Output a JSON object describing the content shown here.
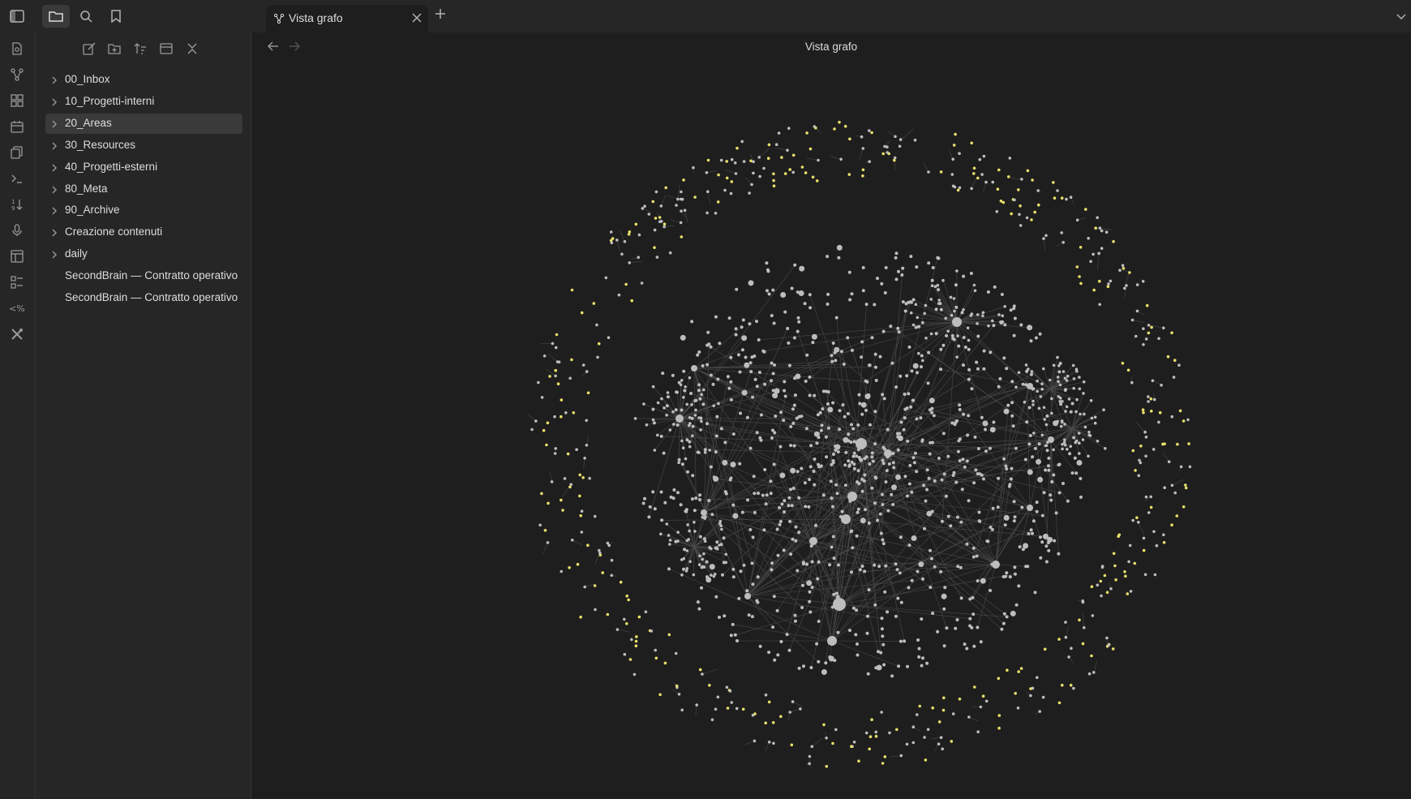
{
  "titlebar": {
    "buttons": [
      "sidebar-toggle-icon",
      "folder-icon",
      "search-icon",
      "bookmark-icon"
    ]
  },
  "tab": {
    "label": "Vista grafo",
    "icon": "graph-icon"
  },
  "ribbon": {
    "icons": [
      "file-search-icon",
      "graph-icon",
      "grid-icon",
      "calendar-icon",
      "copy-icon",
      "terminal-icon",
      "sort-numeric-icon",
      "microphone-icon",
      "layout-icon",
      "list-checks-icon",
      "template-icon",
      "tools-icon"
    ]
  },
  "sidebar": {
    "tools": [
      "new-note-icon",
      "new-folder-icon",
      "sort-icon",
      "collapse-view-icon",
      "collapse-all-icon"
    ],
    "items": [
      {
        "label": "00_Inbox",
        "folder": true
      },
      {
        "label": "10_Progetti-interni",
        "folder": true
      },
      {
        "label": "20_Areas",
        "folder": true,
        "selected": true
      },
      {
        "label": "30_Resources",
        "folder": true
      },
      {
        "label": "40_Progetti-esterni",
        "folder": true
      },
      {
        "label": "80_Meta",
        "folder": true
      },
      {
        "label": "90_Archive",
        "folder": true
      },
      {
        "label": "Creazione contenuti",
        "folder": true
      },
      {
        "label": "daily",
        "folder": true
      },
      {
        "label": "SecondBrain — Contratto operativo",
        "folder": false
      },
      {
        "label": "SecondBrain — Contratto operativo",
        "folder": false
      }
    ]
  },
  "main": {
    "title": "Vista grafo"
  },
  "colors": {
    "background": "#1e1e1e",
    "node": "#bdbdbd",
    "orphan_node": "#e8e06a",
    "edge": "#4a4a4a"
  }
}
